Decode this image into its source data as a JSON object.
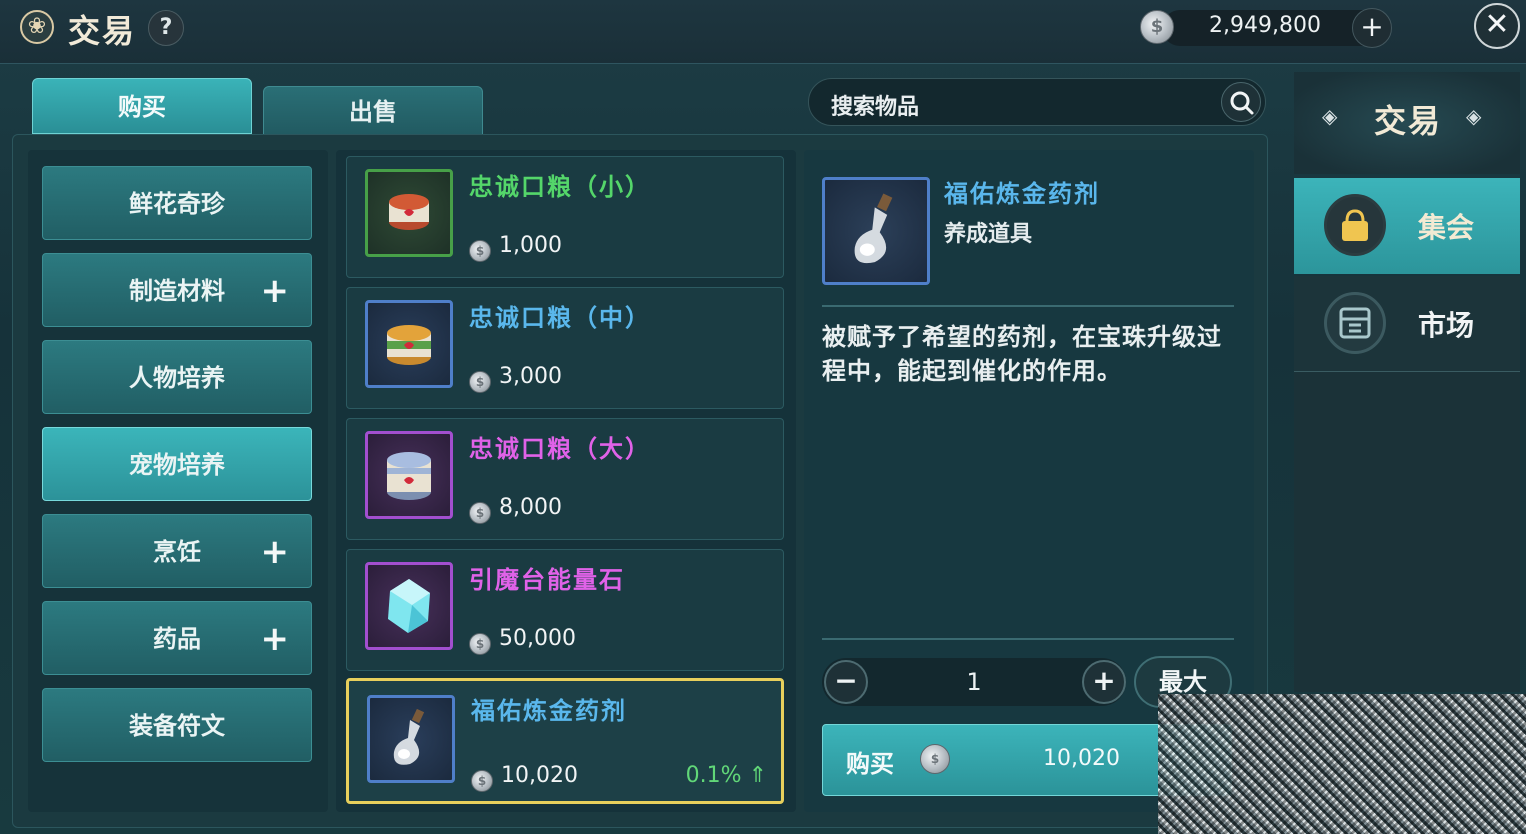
{
  "header": {
    "title": "交易",
    "help_symbol": "?",
    "balance": "2,949,800",
    "add_symbol": "+",
    "close_symbol": "✕"
  },
  "tabs": [
    {
      "label": "购买",
      "active": true
    },
    {
      "label": "出售",
      "active": false
    }
  ],
  "search": {
    "placeholder": "搜索物品"
  },
  "categories": [
    {
      "label": "鲜花奇珍",
      "expandable": false,
      "selected": false
    },
    {
      "label": "制造材料",
      "expandable": true,
      "selected": false
    },
    {
      "label": "人物培养",
      "expandable": false,
      "selected": false
    },
    {
      "label": "宠物培养",
      "expandable": false,
      "selected": true
    },
    {
      "label": "烹饪",
      "expandable": true,
      "selected": false
    },
    {
      "label": "药品",
      "expandable": true,
      "selected": false
    },
    {
      "label": "装备符文",
      "expandable": false,
      "selected": false
    }
  ],
  "category_plus": "+",
  "items": [
    {
      "name": "忠诚口粮（小）",
      "price": "1,000",
      "rarity": "green",
      "icon": "food-can-small-icon"
    },
    {
      "name": "忠诚口粮（中）",
      "price": "3,000",
      "rarity": "blue",
      "icon": "food-can-medium-icon"
    },
    {
      "name": "忠诚口粮（大）",
      "price": "8,000",
      "rarity": "purple",
      "icon": "food-can-large-icon"
    },
    {
      "name": "引魔台能量石",
      "price": "50,000",
      "rarity": "purple",
      "icon": "crystal-icon"
    },
    {
      "name": "福佑炼金药剂",
      "price": "10,020",
      "rarity": "blue",
      "icon": "potion-flask-icon",
      "trend": "0.1%",
      "trend_symbol": "⇑",
      "selected": true
    }
  ],
  "detail": {
    "name": "福佑炼金药剂",
    "type": "养成道具",
    "description": "被赋予了希望的药剂，在宝珠升级过程中，能起到催化的作用。",
    "quantity": "1",
    "minus_symbol": "−",
    "plus_symbol": "+",
    "max_label": "最大",
    "buy_label": "购买",
    "total_price": "10,020"
  },
  "sidebar": {
    "title": "交易",
    "items": [
      {
        "label": "集会",
        "icon": "bag-icon",
        "active": true
      },
      {
        "label": "市场",
        "icon": "market-icon",
        "active": false
      }
    ]
  },
  "colors": {
    "accent_teal": "#3ab3b8",
    "rarity_green": "#54d66a",
    "rarity_blue": "#5ab7ec",
    "rarity_purple": "#e062e8",
    "selected_border": "#e7cf5c"
  }
}
